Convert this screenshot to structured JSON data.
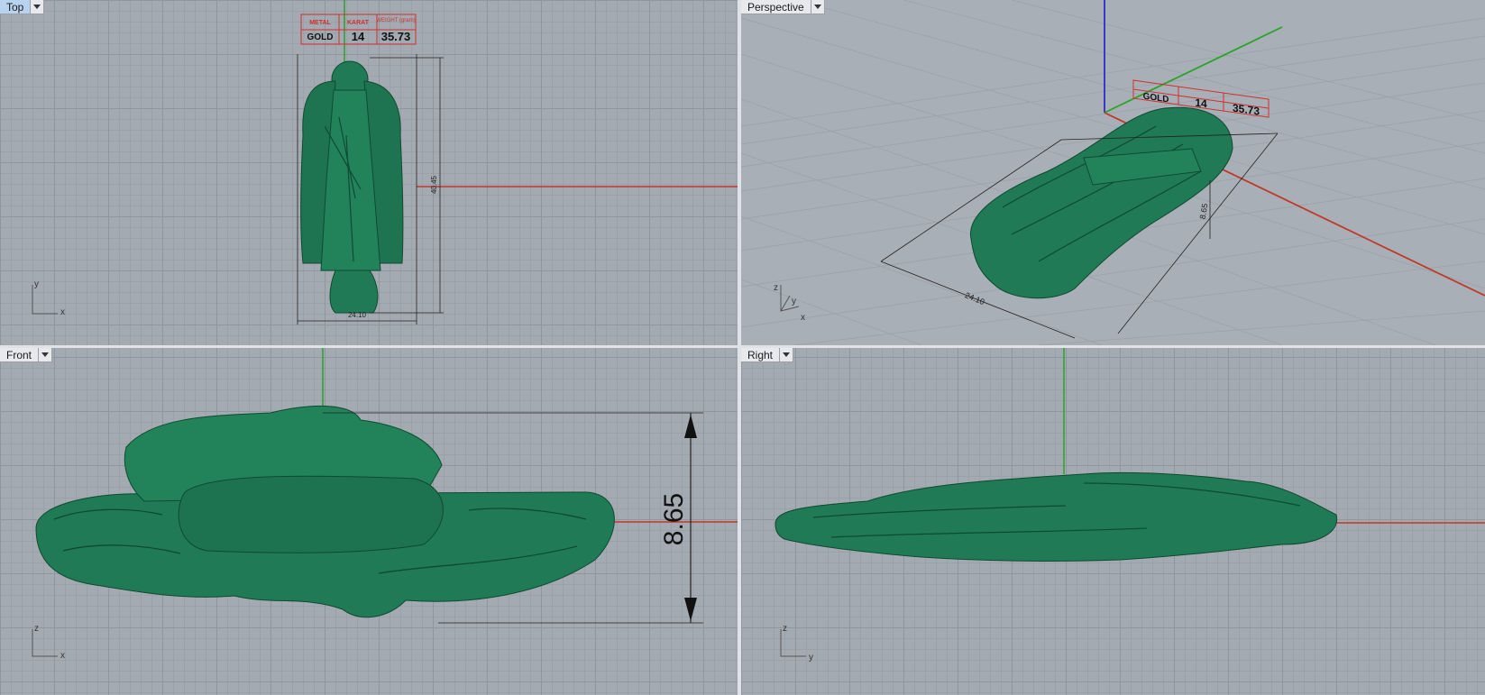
{
  "viewports": {
    "top": {
      "title": "Top",
      "axis_a": "y",
      "axis_b": "x",
      "dim_width": "24.10",
      "dim_height": "40.45"
    },
    "perspective": {
      "title": "Perspective",
      "axis_a": "z",
      "axis_b": "y",
      "axis_c": "x",
      "dim_width": "24.10",
      "dim_height": "8.65"
    },
    "front": {
      "title": "Front",
      "axis_a": "z",
      "axis_b": "x",
      "dim_height": "8.65"
    },
    "right": {
      "title": "Right",
      "axis_a": "z",
      "axis_b": "y"
    }
  },
  "info_table": {
    "headers": [
      "METAL",
      "KARAT",
      "WEIGHT (gram)"
    ],
    "values": [
      "GOLD",
      "14",
      "35.73"
    ]
  },
  "colors": {
    "model": "#1f7a55",
    "x_axis": "#c0392b",
    "y_axis": "#2aa32a",
    "z_axis": "#2b2bd0",
    "table": "#d03030"
  },
  "icons": {
    "viewport_menu": "chevron-down-icon"
  }
}
